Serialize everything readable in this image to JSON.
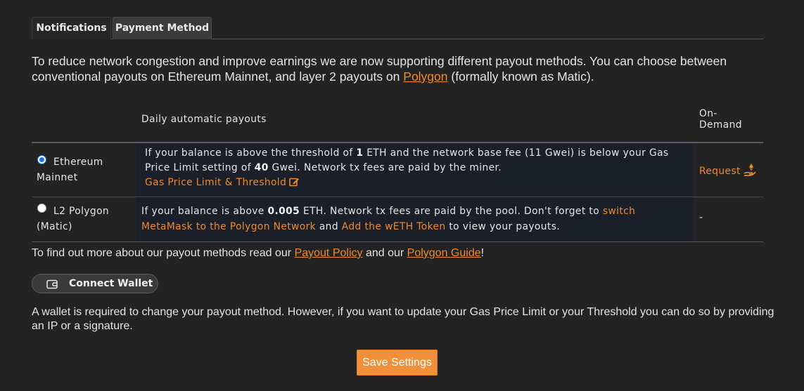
{
  "tabs": {
    "notifications": "Notifications",
    "payment_method": "Payment Method"
  },
  "intro": {
    "text_before_link": "To reduce network congestion and improve earnings we are now supporting different payout methods. You can choose between conventional payouts on Ethereum Mainnet, and layer 2 payouts on ",
    "link": "Polygon",
    "text_after_link": " (formally known as Matic)."
  },
  "table": {
    "header_daily": "Daily automatic payouts",
    "header_on_demand_line1": "On-",
    "header_on_demand_line2": "Demand",
    "rows": [
      {
        "selected": true,
        "method_line1": "Ethereum",
        "method_line2": "Mainnet",
        "desc_parts": [
          "If your balance is above the threshold of ",
          "1",
          " ETH and the network base fee (11 Gwei) is below your Gas",
          "Price Limit setting of ",
          "40",
          " Gwei. Network tx fees are paid by the miner."
        ],
        "link": "Gas Price Limit & Threshold",
        "on_demand": "Request"
      },
      {
        "selected": false,
        "method_line1": "L2 Polygon",
        "method_line2": "(Matic)",
        "desc_parts": [
          "If your balance is above ",
          "0.005",
          " ETH. Network tx fees are paid by the pool. Don't forget to ",
          "switch",
          "MetaMask to the Polygon Network",
          " and ",
          "Add the wETH Token",
          " to view your payouts."
        ],
        "on_demand": "-"
      }
    ]
  },
  "findout": {
    "before": "To find out more about our payout methods read our ",
    "link1": "Payout Policy",
    "middle": " and our ",
    "link2": "Polygon Guide",
    "after": "!"
  },
  "wallet": {
    "button_label": "Connect Wallet",
    "note": "A wallet is required to change your payout method. However, if you want to update your Gas Price Limit or your Threshold you can do so by providing an IP or a signature."
  },
  "save_label": "Save Settings",
  "colors": {
    "accent": "#f08a2a",
    "background": "#232323",
    "row_shade": "#1b1f2a",
    "radio_selected": "#1a73e8"
  }
}
